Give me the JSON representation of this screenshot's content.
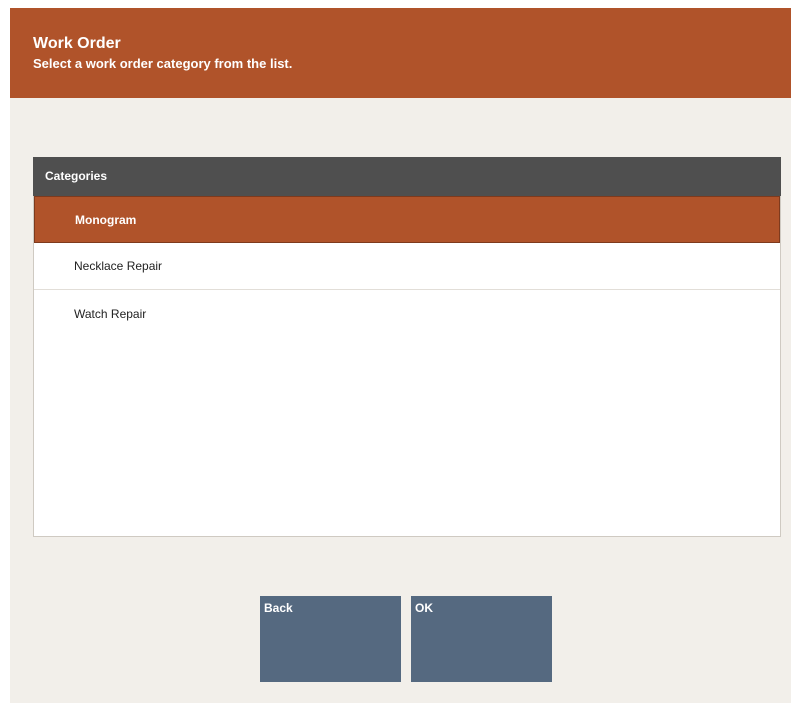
{
  "header": {
    "title": "Work Order",
    "subtitle": "Select a work order category from the list."
  },
  "list": {
    "header": "Categories",
    "items": [
      {
        "label": "Monogram",
        "selected": true
      },
      {
        "label": "Necklace Repair",
        "selected": false
      },
      {
        "label": "Watch Repair",
        "selected": false
      }
    ]
  },
  "buttons": {
    "back": "Back",
    "ok": "OK"
  },
  "colors": {
    "accent": "#b0532a",
    "button": "#556980",
    "list_header": "#4f4f4f",
    "background": "#f2efea"
  }
}
